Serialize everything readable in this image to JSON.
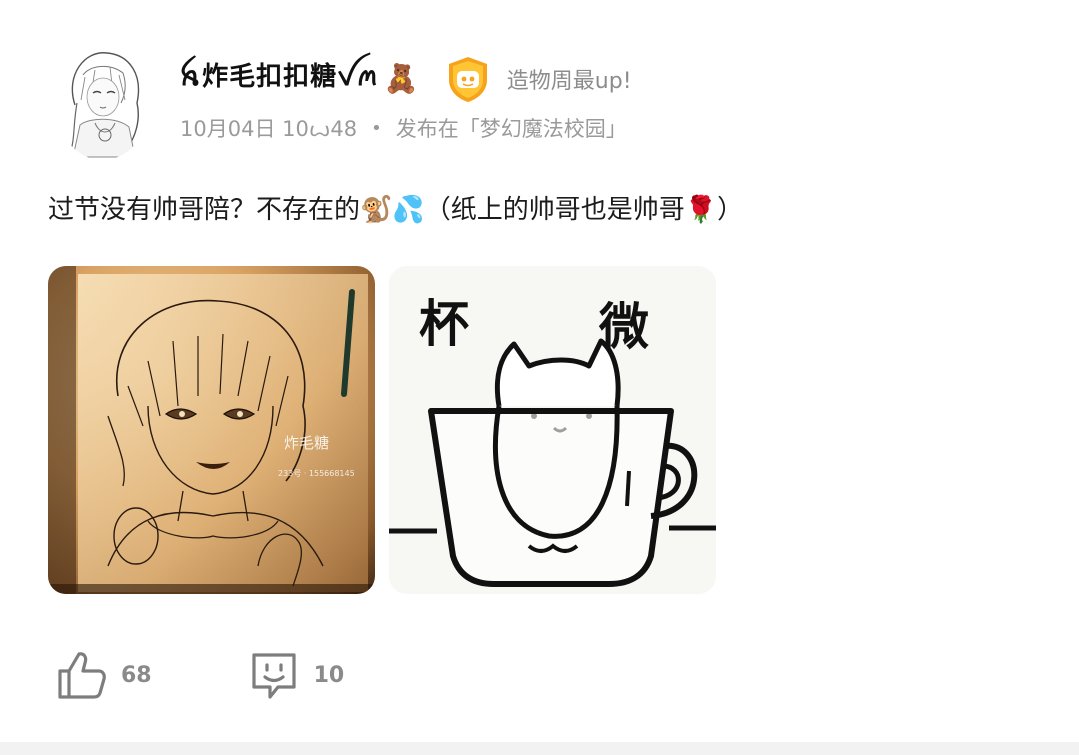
{
  "post": {
    "author": {
      "name": "ꫝ炸毛扣扣糖ꪜꪔ",
      "name_emoji": "🧸",
      "badge_label": "造物周最up!"
    },
    "meta": {
      "date": "10月04日 10ꙍ48",
      "separator": "•",
      "published_in": "发布在「梦幻魔法校园」"
    },
    "content": "过节没有帅哥陪？不存在的🐒💦（纸上的帅哥也是帅哥🌹）",
    "images": [
      {
        "type": "drawing",
        "watermark_title": "炸毛糖",
        "watermark_id": "233号 · 155668145"
      },
      {
        "type": "meme",
        "caption_left": "杯",
        "caption_right": "微"
      }
    ],
    "actions": {
      "like_count": "68",
      "comment_count": "10"
    }
  },
  "colors": {
    "text_primary": "#1c1c1c",
    "text_secondary": "#9a9a9a",
    "badge_orange": "#f7a21b",
    "icon_gray": "#7d7d7d"
  }
}
